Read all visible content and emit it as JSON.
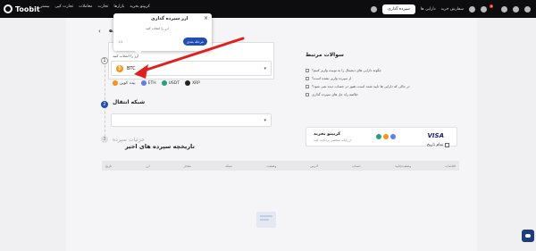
{
  "brand": {
    "name": "Toobit"
  },
  "topnav": {
    "items": [
      "کریپتو بخرید",
      "بازارها",
      "تجارت",
      "معاملات",
      "تجارت کپی",
      "بیشتر"
    ],
    "deposit": "سپرده گذاری",
    "assets": "دارایی ها",
    "orders": "سفارش خرید",
    "badge": "4"
  },
  "page": {
    "title": "سپرده",
    "back": "‹"
  },
  "steps": {
    "s1": "1",
    "s2": "2",
    "s3": "3",
    "select_label": "ارز را انتخاب کنید",
    "selected_coin": {
      "symbol": "BTC",
      "icon": "₿"
    },
    "quick_coins": [
      "بیت کوین",
      "ETH",
      "USDT",
      "XRP"
    ],
    "network_title": "شبکه انتقال",
    "details_title": "جزئیات سپرده"
  },
  "faq": {
    "title": "سوالات مرتبط",
    "items": [
      "چگونه دارایی های دیجیتال را به توبیت واریز کنیم؟",
      "از سپرده واریز نشده است؟",
      "در حالی که دارایی ها تایید شده است، هنوز در حساب دیده نمی شود؟",
      "خلاصه راه حل های سپرده گذاری"
    ]
  },
  "buy_card": {
    "title": "کریپتو بخرید",
    "subtitle": "از رایانه شخصی پرداخت کنید",
    "visa": "VISA"
  },
  "history": {
    "title": "تاریخچه سپرده های اخیر",
    "checkbox": "تمام تاریخ",
    "columns": [
      "تاریخ",
      "ارز",
      "مقدار",
      "شبکه",
      "وضعیت",
      "آدرس",
      "حساب",
      "وضعیت/تایید",
      "اقدامات"
    ]
  },
  "tooltip": {
    "title": "ارز سپرده گذاری",
    "body": "ارز را انتخاب کنید",
    "step": "1/2",
    "next": "مرحله بعدی",
    "close": "×"
  },
  "colors": {
    "primary": "#1f4fb5",
    "arrow": "#e02020",
    "btc": "#f7931a"
  }
}
